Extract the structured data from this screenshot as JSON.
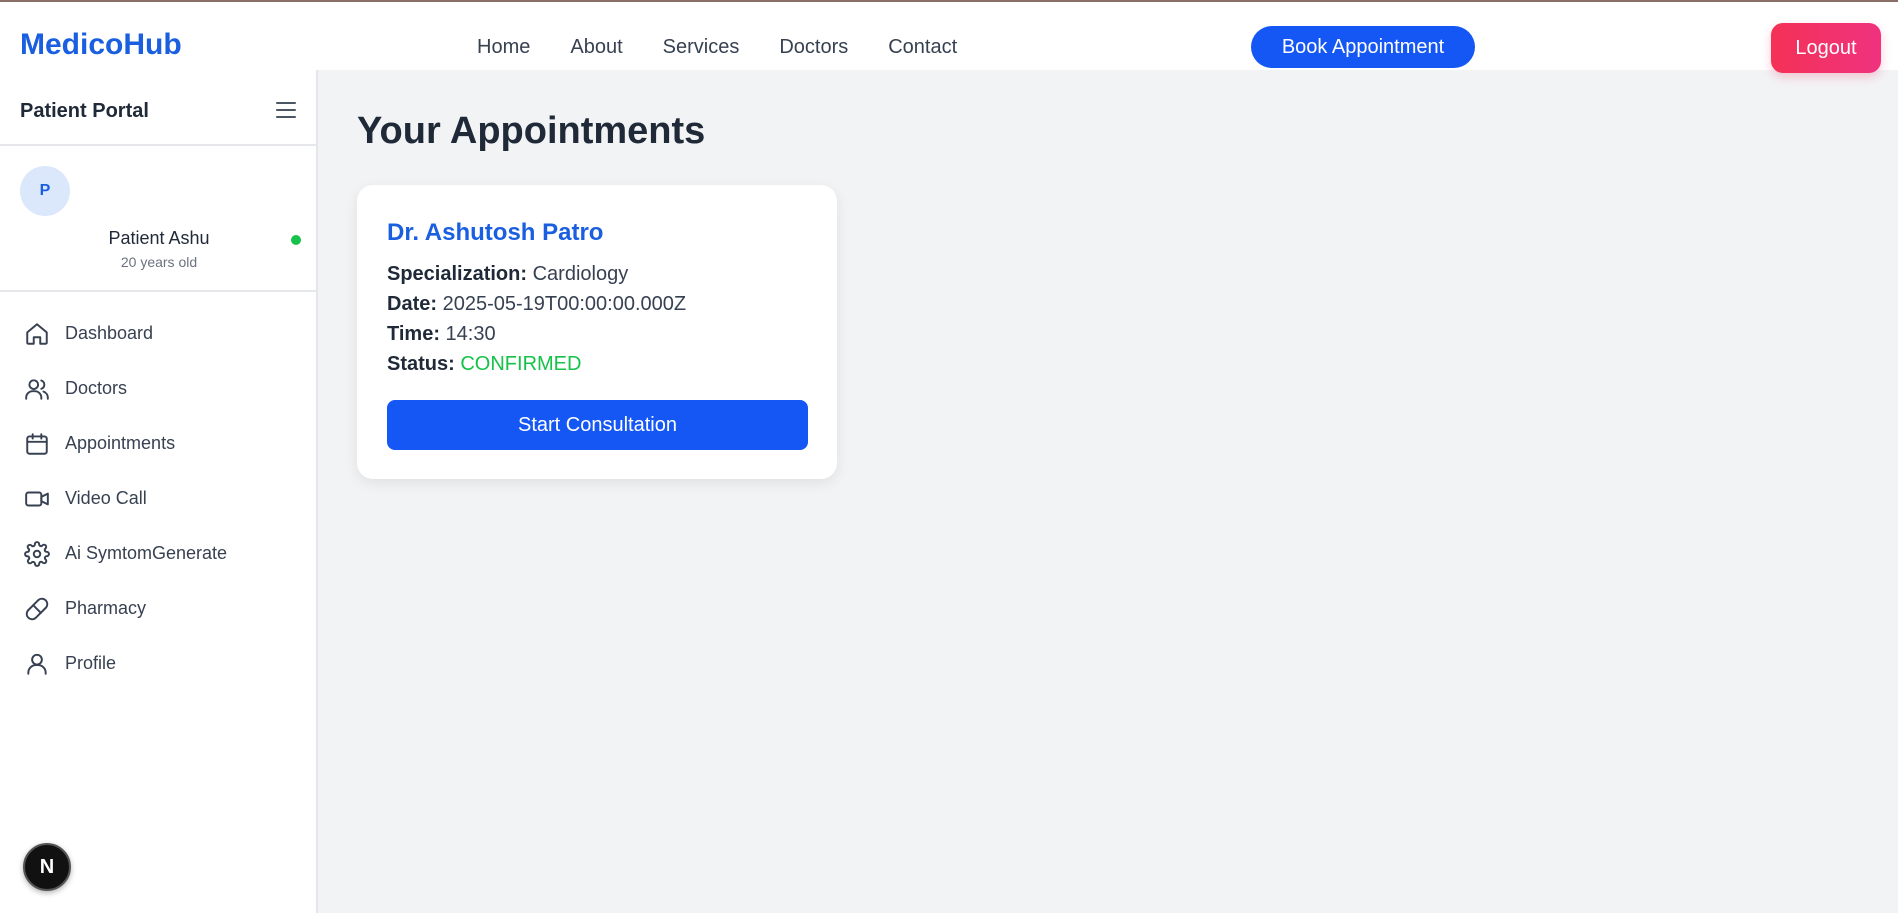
{
  "header": {
    "brand": "MedicoHub",
    "nav": [
      "Home",
      "About",
      "Services",
      "Doctors",
      "Contact"
    ],
    "book_label": "Book Appointment",
    "logout_label": "Logout"
  },
  "sidebar": {
    "title": "Patient Portal",
    "profile": {
      "avatar_letter": "P",
      "name": "Patient Ashu",
      "age": "20 years old",
      "status_color": "#16c24a"
    },
    "items": [
      {
        "label": "Dashboard",
        "icon": "home-icon"
      },
      {
        "label": "Doctors",
        "icon": "users-icon"
      },
      {
        "label": "Appointments",
        "icon": "calendar-icon"
      },
      {
        "label": "Video Call",
        "icon": "video-icon"
      },
      {
        "label": "Ai SymtomGenerate",
        "icon": "gear-icon"
      },
      {
        "label": "Pharmacy",
        "icon": "pill-icon"
      },
      {
        "label": "Profile",
        "icon": "user-icon"
      }
    ],
    "floating_badge": "N"
  },
  "main": {
    "title": "Your Appointments",
    "appointments": [
      {
        "doctor": "Dr. Ashutosh Patro",
        "specialization_label": "Specialization:",
        "specialization": "Cardiology",
        "date_label": "Date:",
        "date": "2025-05-19T00:00:00.000Z",
        "time_label": "Time:",
        "time": "14:30",
        "status_label": "Status:",
        "status": "CONFIRMED",
        "action_label": "Start Consultation"
      }
    ]
  },
  "colors": {
    "accent": "#1557f5",
    "brand": "#1a5fe0",
    "logout": "#f43156",
    "confirmed": "#16c24a"
  }
}
